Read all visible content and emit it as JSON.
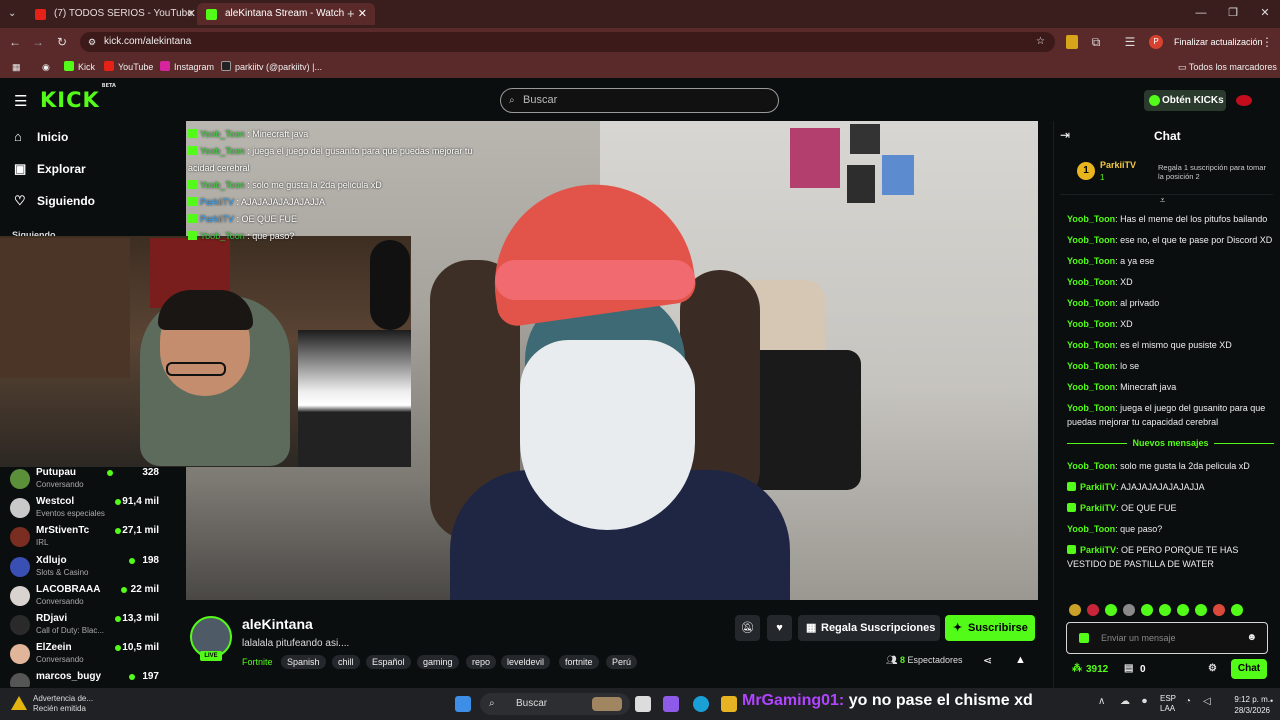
{
  "browser": {
    "tabs": [
      {
        "title": "(7) TODOS SERIOS - YouTube"
      },
      {
        "title": "aleKintana Stream - Watch"
      }
    ],
    "url": "kick.com/alekintana",
    "update_label": "Finalizar actualización",
    "profile_initial": "P",
    "bookmarks": [
      "Kick",
      "YouTube",
      "Instagram",
      "parkiitv (@parkiitv) |..."
    ],
    "all_bookmarks_label": "Todos los marcadores"
  },
  "kick": {
    "logo": "KICK",
    "logo_badge": "BETA",
    "search_placeholder": "Buscar",
    "get_kicks_label": "Obtén KICKs",
    "nav": [
      {
        "label": "Inicio",
        "icon": "home-icon"
      },
      {
        "label": "Explorar",
        "icon": "compass-icon"
      },
      {
        "label": "Siguiendo",
        "icon": "heart-icon"
      }
    ],
    "following_heading": "Siguiendo",
    "following": [
      {
        "name": "Putupau",
        "category": "Conversando",
        "viewers": "328",
        "color": "#5b8f3a"
      },
      {
        "name": "Westcol",
        "category": "Eventos especiales",
        "viewers": "91,4 mil",
        "color": "#c9c9c9"
      },
      {
        "name": "MrStivenTc",
        "category": "IRL",
        "viewers": "27,1 mil",
        "color": "#7a2e22"
      },
      {
        "name": "Xdlujo",
        "category": "Slots & Casino",
        "viewers": "198",
        "color": "#3a4fb3"
      },
      {
        "name": "LACOBRAAA",
        "category": "Conversando",
        "viewers": "22 mil",
        "color": "#d9d3cf"
      },
      {
        "name": "RDjavi",
        "category": "Call of Duty: Blac...",
        "viewers": "13,3 mil",
        "color": "#2a2a2a"
      },
      {
        "name": "ElZeein",
        "category": "Conversando",
        "viewers": "10,5 mil",
        "color": "#e0b59a"
      },
      {
        "name": "marcos_bugy",
        "category": "",
        "viewers": "197",
        "color": "#555"
      }
    ]
  },
  "video_chat_overlay": [
    {
      "user": "Yoob_Toon",
      "text": ": Minecraft java",
      "badge": "kick"
    },
    {
      "user": "Yoob_Toon",
      "text": ": juega el juego del gusanito para que puedas mejorar tu",
      "badge": "kick"
    },
    {
      "user": "",
      "text": "acidad cerebral",
      "badge": ""
    },
    {
      "user": "Yoob_Toon",
      "text": ": solo me gusta la 2da pelicula xD",
      "badge": "kick"
    },
    {
      "user": "ParkiiTV",
      "text": ": AJAJAJAJAJAJAJJA",
      "badge": "kick"
    },
    {
      "user": "ParkiiTV",
      "text": ": OE QUE FUE",
      "badge": "kick"
    },
    {
      "user": "Yoob_Toon",
      "text": ": que paso?",
      "badge": "kick"
    }
  ],
  "stream": {
    "channel": "aleKintana",
    "title": "lalalala pitufeando asi....",
    "category": "Fortnite",
    "tags": [
      "Spanish",
      "chill",
      "Español",
      "gaming",
      "repo",
      "leveldevil",
      "fortnite",
      "Perú"
    ],
    "live_label": "LIVE",
    "gift_label": "Regala Suscripciones",
    "subscribe_label": "Suscribirse",
    "viewers_count": "8",
    "viewers_label": "Espectadores"
  },
  "chat": {
    "title": "Chat",
    "pinned": {
      "rank": "1",
      "user": "ParkiiTV",
      "count": "1",
      "cta": "Regala 1 suscripción para tomar la posición 2"
    },
    "messages": [
      {
        "user": "Yoob_Toon",
        "text": "Has el meme del los pitufos bailando",
        "badge": false
      },
      {
        "user": "Yoob_Toon",
        "text": "ese no, el que te pase por Discord XD",
        "badge": false
      },
      {
        "user": "Yoob_Toon",
        "text": "a ya ese",
        "badge": false
      },
      {
        "user": "Yoob_Toon",
        "text": "XD",
        "badge": false
      },
      {
        "user": "Yoob_Toon",
        "text": "al privado",
        "badge": false
      },
      {
        "user": "Yoob_Toon",
        "text": "XD",
        "badge": false
      },
      {
        "user": "Yoob_Toon",
        "text": "es el mismo que pusiste XD",
        "badge": false
      },
      {
        "user": "Yoob_Toon",
        "text": "lo se",
        "badge": false
      },
      {
        "user": "Yoob_Toon",
        "text": "Minecraft java",
        "badge": false
      },
      {
        "user": "Yoob_Toon",
        "text": "juega el juego del gusanito para que puedas mejorar tu capacidad cerebral",
        "badge": false
      }
    ],
    "new_messages_label": "Nuevos mensajes",
    "new_messages": [
      {
        "user": "Yoob_Toon",
        "text": "solo me gusta la 2da pelicula xD",
        "badge": false
      },
      {
        "user": "ParkiiTV",
        "text": "AJAJAJAJAJAJAJJA",
        "badge": true
      },
      {
        "user": "ParkiiTV",
        "text": "OE QUE FUE",
        "badge": true
      },
      {
        "user": "Yoob_Toon",
        "text": "que paso?",
        "badge": false
      },
      {
        "user": "ParkiiTV",
        "text": "OE PERO PORQUE TE HAS VESTIDO DE PASTILLA DE WATER",
        "badge": true
      }
    ],
    "input_placeholder": "Enviar un mensaje",
    "points": "3912",
    "gifts": "0",
    "send_label": "Chat"
  },
  "taskbar": {
    "notification_title": "Advertencia de...",
    "notification_sub": "Recién emitida",
    "search_placeholder": "Buscar",
    "overlay_user": "MrGaming01:",
    "overlay_text": "yo no pase el chisme xd",
    "lang_top": "ESP",
    "lang_bottom": "LAA",
    "time": "9:12 p. m.",
    "date": "28/3/2026"
  }
}
